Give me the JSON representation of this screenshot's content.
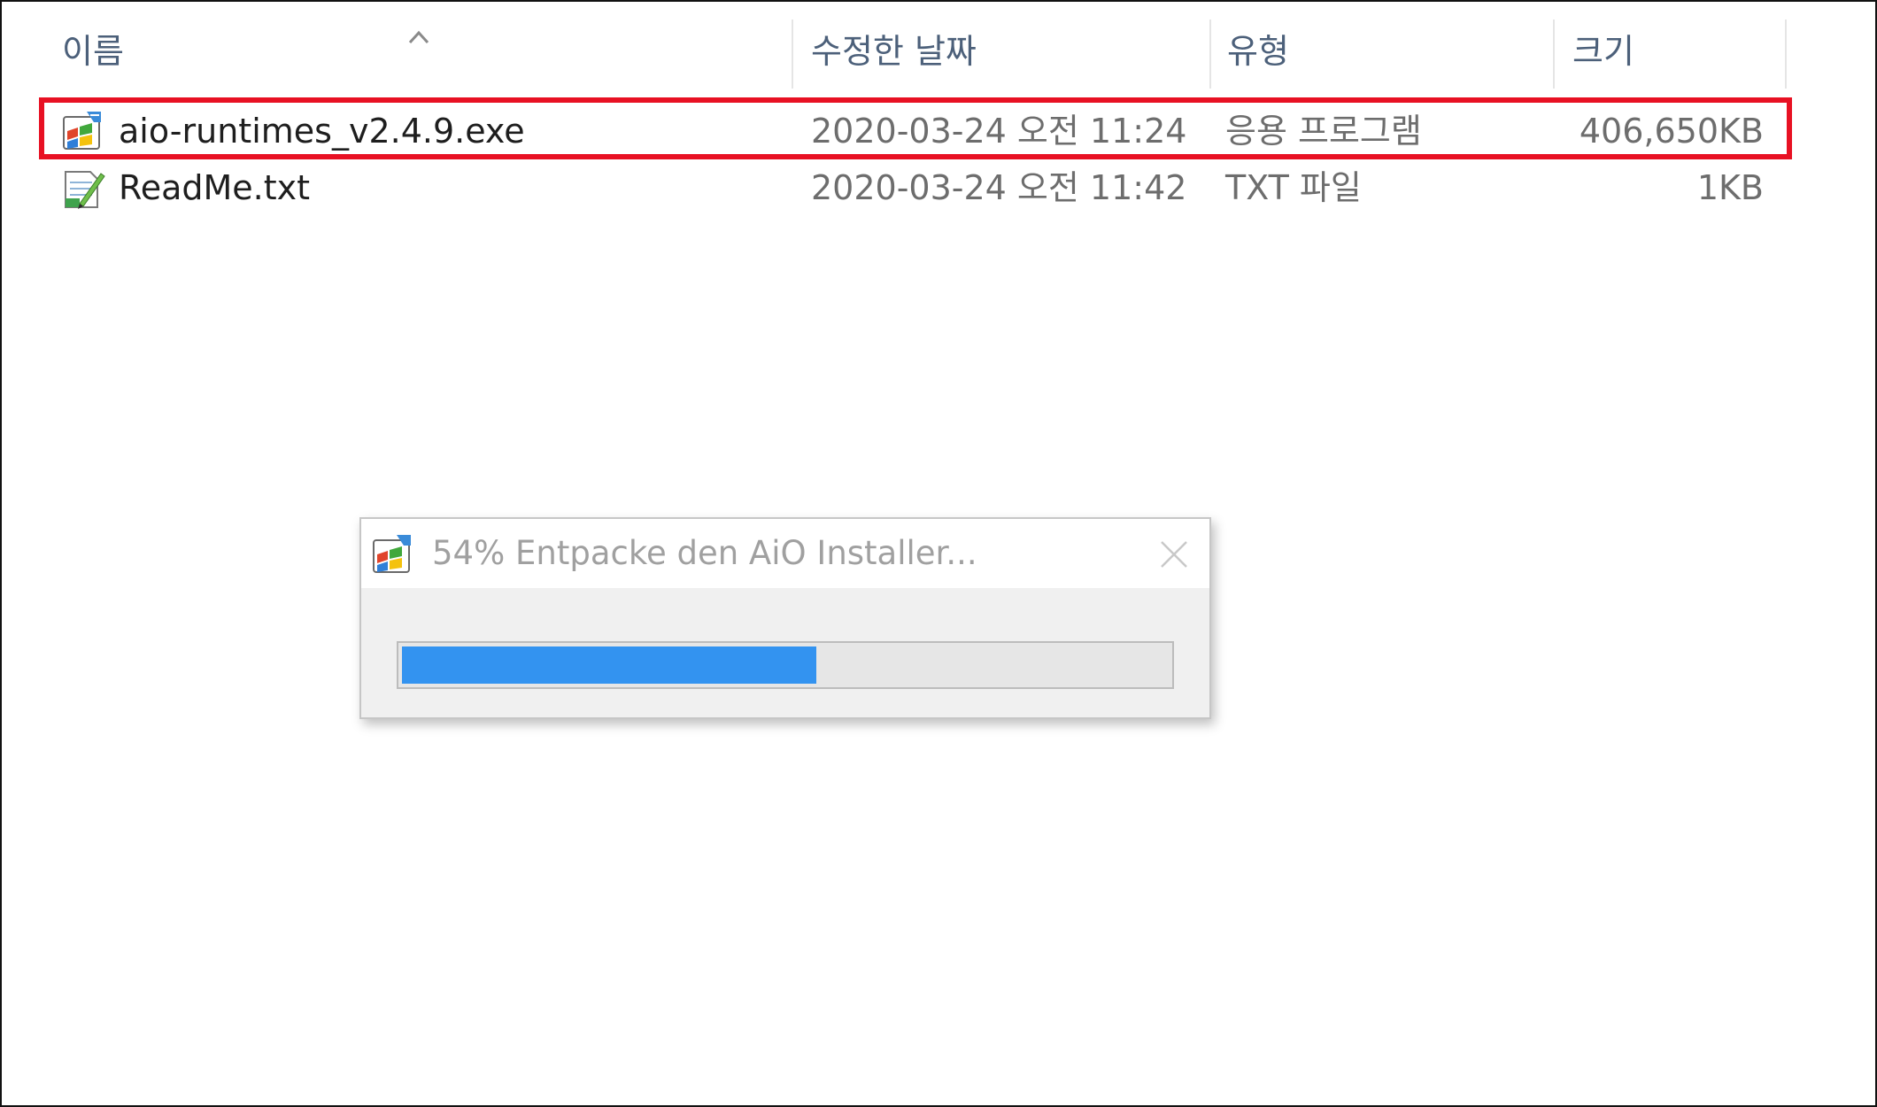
{
  "columns": {
    "name": "이름",
    "date_modified": "수정한 날짜",
    "type": "유형",
    "size": "크기"
  },
  "sort": {
    "column": "name",
    "direction": "ascending",
    "icon": "chevron-up-icon"
  },
  "files": [
    {
      "name": "aio-runtimes_v2.4.9.exe",
      "date_modified": "2020-03-24 오전 11:24",
      "type": "응용 프로그램",
      "size": "406,650KB",
      "icon": "installer-exe-icon",
      "highlighted": true
    },
    {
      "name": "ReadMe.txt",
      "date_modified": "2020-03-24 오전 11:42",
      "type": "TXT 파일",
      "size": "1KB",
      "icon": "text-file-icon",
      "highlighted": false
    }
  ],
  "highlight_color": "#e81123",
  "dialog": {
    "title": "54% Entpacke den AiO Installer...",
    "icon": "installer-icon",
    "close_icon": "close-icon",
    "progress": 0.54,
    "progress_color": "#3393f0"
  }
}
